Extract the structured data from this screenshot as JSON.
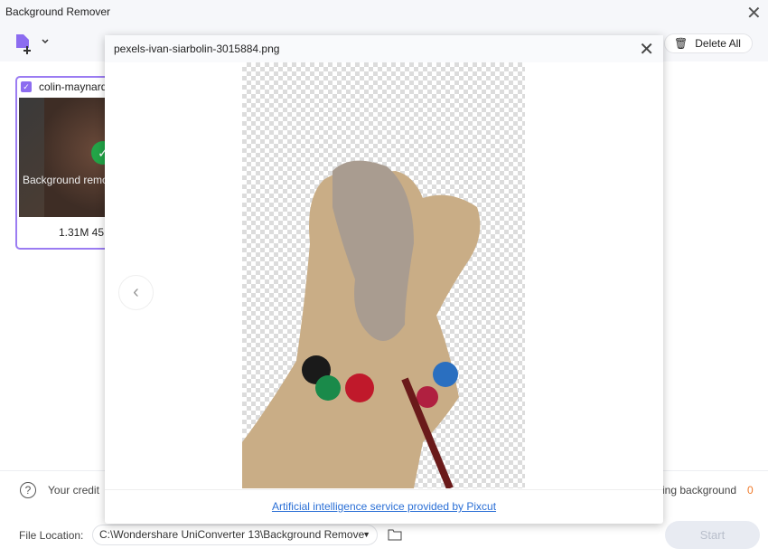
{
  "window": {
    "title": "Background Remover"
  },
  "toolbar": {
    "delete_all": "Delete All"
  },
  "card": {
    "filename": "colin-maynard",
    "status": "Background remo",
    "meta": "1.31M  45"
  },
  "footer": {
    "credit_text": "Your credit",
    "bg_text": "ing background",
    "count": "0",
    "file_location_label": "File Location:",
    "path": "C:\\Wondershare UniConverter 13\\Background Remove",
    "start": "Start"
  },
  "dialog": {
    "filename": "pexels-ivan-siarbolin-3015884.png",
    "link": "Artificial intelligence service provided by Pixcut"
  },
  "colors": {
    "accent": "#8c6cf0",
    "success": "#22a447",
    "count": "#f07a2a",
    "link": "#2a6fd6"
  }
}
